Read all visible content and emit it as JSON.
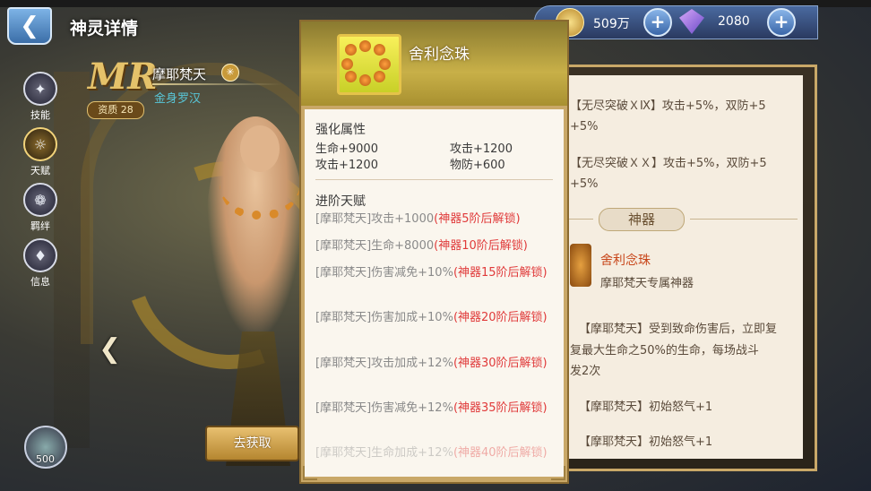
{
  "header": {
    "title": "神灵详情"
  },
  "side_menu": [
    {
      "label": "技能",
      "icon": "skill-icon",
      "active": false
    },
    {
      "label": "天赋",
      "icon": "talent-icon",
      "active": true
    },
    {
      "label": "羁绊",
      "icon": "bond-icon",
      "active": false
    },
    {
      "label": "信息",
      "icon": "info-icon",
      "active": false
    }
  ],
  "hero": {
    "rank_badge": "MR",
    "aptitude": "资质 28",
    "name": "摩耶梵天",
    "subtitle": "金身罗汉"
  },
  "currency": {
    "gold": "509万",
    "diamond": "2080"
  },
  "gem_button": {
    "count": "500"
  },
  "acquire_button": {
    "label": "去获取"
  },
  "right_panel": {
    "lines": [
      {
        "bracket": "【无尽突破ＸⅨ】",
        "text": "攻击+5%，双防+5%+5%"
      },
      {
        "bracket": "【无尽突破ＸＸ】",
        "text": "攻击+5%，双防+5%+5%"
      }
    ],
    "line1_a": "【无尽突破ＸⅨ】攻击+5%，双防+5",
    "line1_b": "+5%",
    "line2_a": "【无尽突破ＸＸ】攻击+5%，双防+5",
    "line2_b": "+5%",
    "section_title": "神器",
    "artifact_name": "舍利念珠",
    "artifact_desc": "摩耶梵天专属神器",
    "effect_1a": "【摩耶梵天】",
    "effect_1b": "受到致命伤害后，立即复",
    "effect_1c": "复最大生命之50%的生命，每场战斗",
    "effect_1d": "发2次",
    "effect_2a": "【摩耶梵天】",
    "effect_2b": "初始怒气+1",
    "effect_3a": "【摩耶梵天】",
    "effect_3b": "初始怒气+1"
  },
  "popup": {
    "title": "舍利念珠",
    "enhance_label": "强化属性",
    "stats": [
      {
        "text": "生命+9000"
      },
      {
        "text": "攻击+1200"
      },
      {
        "text": "攻击+1200"
      },
      {
        "text": "物防+600"
      }
    ],
    "advance_label": "进阶天赋",
    "talents": [
      {
        "text": "[摩耶梵天]攻击+1000",
        "lock": "(神器5阶后解锁)"
      },
      {
        "text": "[摩耶梵天]生命+8000",
        "lock": "(神器10阶后解锁)"
      },
      {
        "text": "[摩耶梵天]伤害减免+10%",
        "lock": "(神器15阶后解锁)"
      },
      {
        "text": "[摩耶梵天]伤害加成+10%",
        "lock": "(神器20阶后解锁)"
      },
      {
        "text": "[摩耶梵天]攻击加成+12%",
        "lock": "(神器30阶后解锁)"
      },
      {
        "text": "[摩耶梵天]伤害减免+12%",
        "lock": "(神器35阶后解锁)"
      },
      {
        "text": "[摩耶梵天]生命加成+12%",
        "lock": "(神器40阶后解锁)"
      }
    ]
  }
}
